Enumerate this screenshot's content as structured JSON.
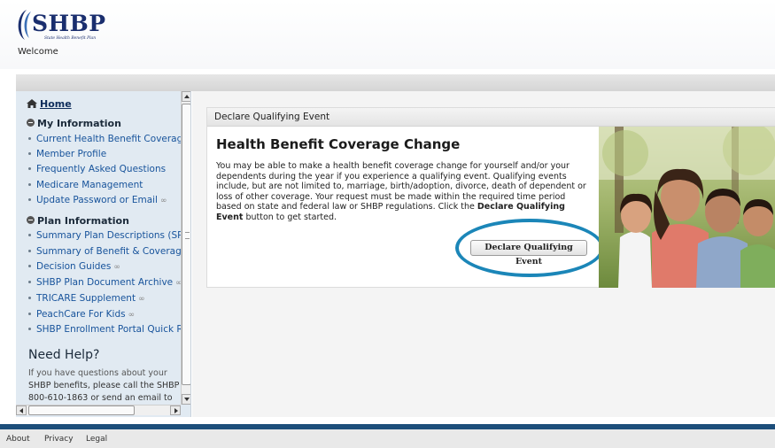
{
  "header": {
    "logo_text": "SHBP",
    "logo_tagline": "State Health Benefit Plan",
    "welcome": "Welcome"
  },
  "sidebar": {
    "home": "Home",
    "sections": [
      {
        "title": "My Information",
        "items": [
          {
            "label": "Current Health Benefit Coverage",
            "external": false
          },
          {
            "label": "Member Profile",
            "external": false
          },
          {
            "label": "Frequently Asked Questions",
            "external": false
          },
          {
            "label": "Medicare Management",
            "external": false
          },
          {
            "label": "Update Password or Email",
            "external": true
          }
        ]
      },
      {
        "title": "Plan Information",
        "items": [
          {
            "label": "Summary Plan Descriptions (SPD",
            "external": false
          },
          {
            "label": "Summary of Benefit & Coverage",
            "external": false
          },
          {
            "label": "Decision Guides",
            "external": true
          },
          {
            "label": "SHBP Plan Document Archive",
            "external": true
          },
          {
            "label": "TRICARE Supplement",
            "external": true
          },
          {
            "label": "PeachCare For Kids",
            "external": true
          },
          {
            "label": "SHBP Enrollment Portal Quick Re",
            "external": false
          }
        ]
      }
    ],
    "help": {
      "title": "Need Help?",
      "line1": "If you have questions about your",
      "line2": "SHBP benefits, please call the SHBP M",
      "line3": "800-610-1863 or send an email to"
    }
  },
  "main": {
    "panel_title": "Declare Qualifying Event",
    "heading": "Health Benefit Coverage Change",
    "description_1": "You may be able to make a health benefit coverage change for yourself and/or your dependents during the year if you experience a qualifying event. Qualifying events include, but are not limited to, marriage, birth/adoption, divorce, death of dependent or loss of other coverage. Your request must be made within the required time period based on state and federal law or SHBP regulations.  Click the ",
    "description_bold": "Declare Qualifying Event",
    "description_2": " button to get started.",
    "button_label": "Declare Qualifying Event"
  },
  "footer": {
    "links": [
      "About",
      "Privacy",
      "Legal"
    ]
  },
  "colors": {
    "brand_navy": "#1a2e6e",
    "link_blue": "#17539b",
    "highlight_ring": "#1b86b8",
    "footer_bar": "#1c4e7a",
    "sidebar_bg": "#e1eaf2"
  },
  "icons": {
    "home": "home-icon",
    "section_toggle": "collapse-circle-icon",
    "external_link": "external-link-icon"
  }
}
